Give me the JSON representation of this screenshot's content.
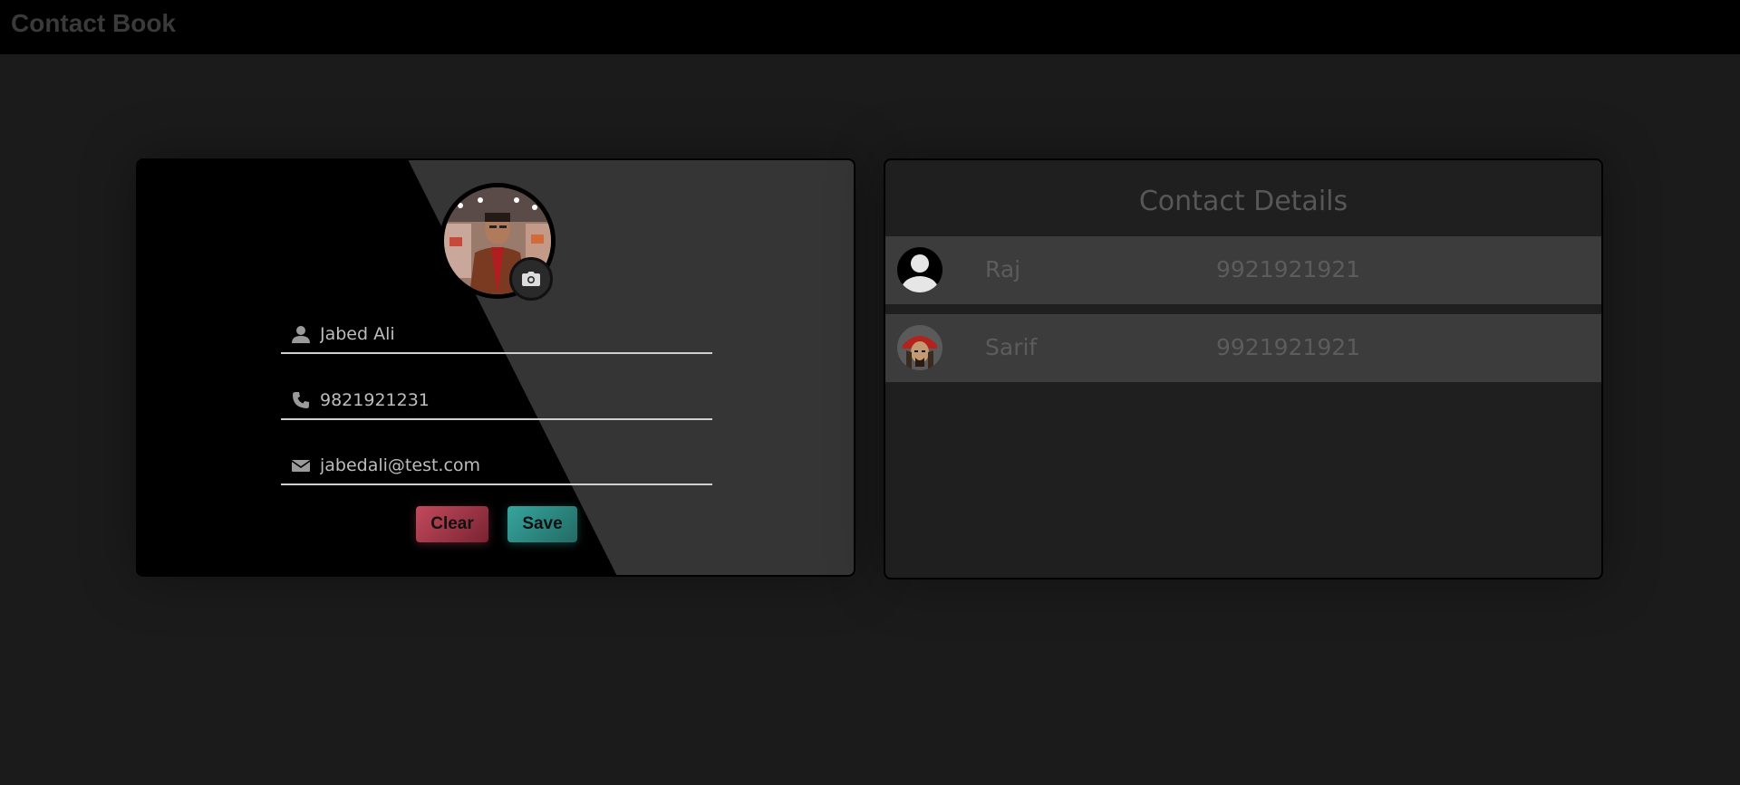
{
  "app": {
    "title": "Contact Book"
  },
  "form": {
    "name_value": "Jabed Ali",
    "phone_value": "9821921231",
    "email_value": "jabedali@test.com",
    "clear_label": "Clear",
    "save_label": "Save",
    "colors": {
      "clear": "#c24a5c",
      "save": "#36a59e"
    }
  },
  "contacts": {
    "title": "Contact Details",
    "items": [
      {
        "name": "Raj",
        "phone": "9921921921",
        "avatar": "default-user-avatar"
      },
      {
        "name": "Sarif",
        "phone": "9921921921",
        "avatar": "pirate-photo-avatar"
      }
    ]
  },
  "icons": [
    "user-icon",
    "phone-icon",
    "mail-icon",
    "camera-icon"
  ]
}
